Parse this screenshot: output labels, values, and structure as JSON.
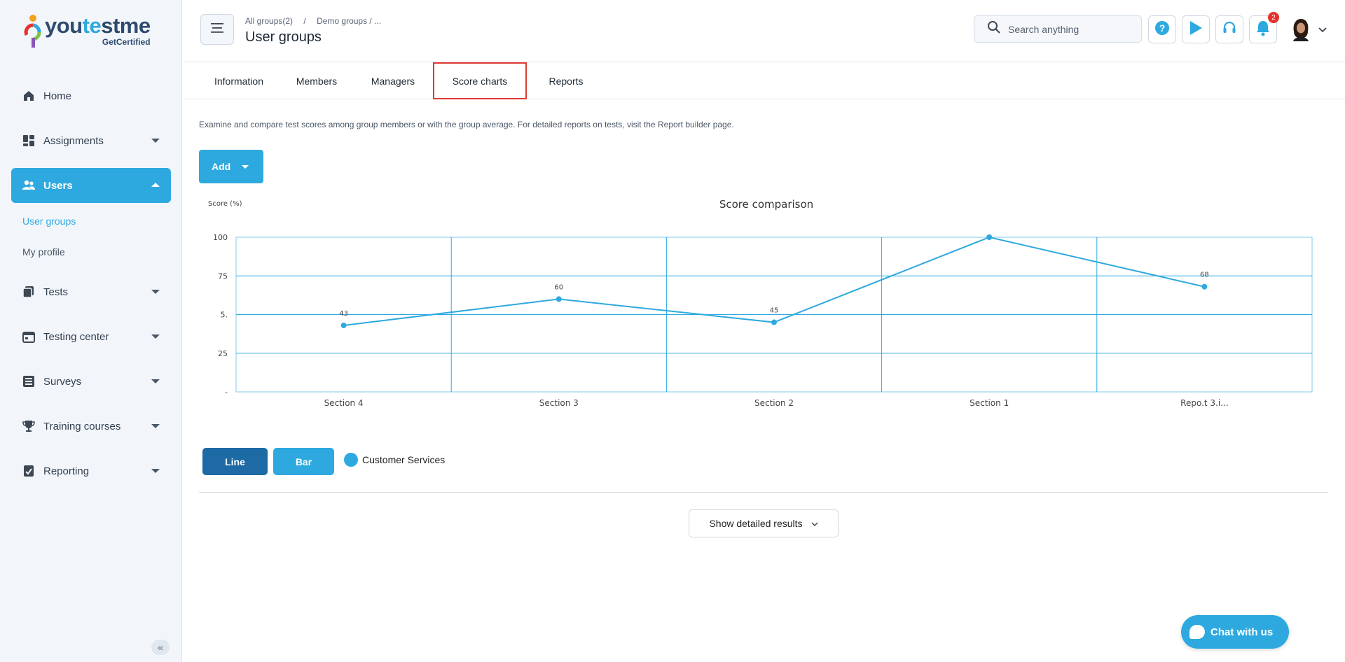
{
  "brand": {
    "logo_prefix": "you",
    "logo_mid": "te",
    "logo_suffix": "stme",
    "tagline": "GetCertified",
    "accent": "#2ea9df"
  },
  "sidebar": {
    "items": [
      {
        "label": "Home",
        "icon": "home-icon"
      },
      {
        "label": "Assignments",
        "icon": "dashboard-icon"
      },
      {
        "label": "Users",
        "icon": "users-icon",
        "active": true
      },
      {
        "label": "Tests",
        "icon": "tests-icon"
      },
      {
        "label": "Testing center",
        "icon": "calendar-icon"
      },
      {
        "label": "Surveys",
        "icon": "list-icon"
      },
      {
        "label": "Training courses",
        "icon": "trophy-icon"
      },
      {
        "label": "Reporting",
        "icon": "report-icon"
      }
    ],
    "subitems": [
      {
        "label": "User groups",
        "current": true
      },
      {
        "label": "My profile"
      }
    ],
    "collapse_glyph": "«"
  },
  "header": {
    "breadcrumb_1": "All groups(2)",
    "breadcrumb_sep": "/",
    "breadcrumb_2": "Demo groups / ...",
    "title": "User groups",
    "search_placeholder": "Search anything",
    "notifications_count": "2"
  },
  "tabs": [
    {
      "label": "Information"
    },
    {
      "label": "Members"
    },
    {
      "label": "Managers"
    },
    {
      "label": "Score charts",
      "active": true
    },
    {
      "label": "Reports"
    }
  ],
  "content": {
    "description": "Examine and compare test scores among group members or with the group average. For detailed reports on tests, visit the Report builder page.",
    "add_label": "Add",
    "line_label": "Line",
    "bar_label": "Bar",
    "detail_label": "Show detailed results"
  },
  "chart_data": {
    "type": "line",
    "title": "Score comparison",
    "ylabel": "Score (%)",
    "xlabel": "",
    "categories": [
      "Section 4",
      "Section 3",
      "Section 2",
      "Section 1",
      "Repo.t 3.i..."
    ],
    "series": [
      {
        "name": "Customer Services",
        "values": [
          43,
          60,
          45,
          100,
          68
        ],
        "color": "#2ea9df"
      }
    ],
    "ylim": [
      0,
      100
    ],
    "yticks": [
      "100",
      "75",
      "5.",
      "25",
      "-"
    ],
    "data_labels": [
      "43",
      "60",
      "45",
      "",
      "68"
    ],
    "grid": true,
    "legend": "bottom-left"
  },
  "chat": {
    "label": "Chat with us"
  }
}
